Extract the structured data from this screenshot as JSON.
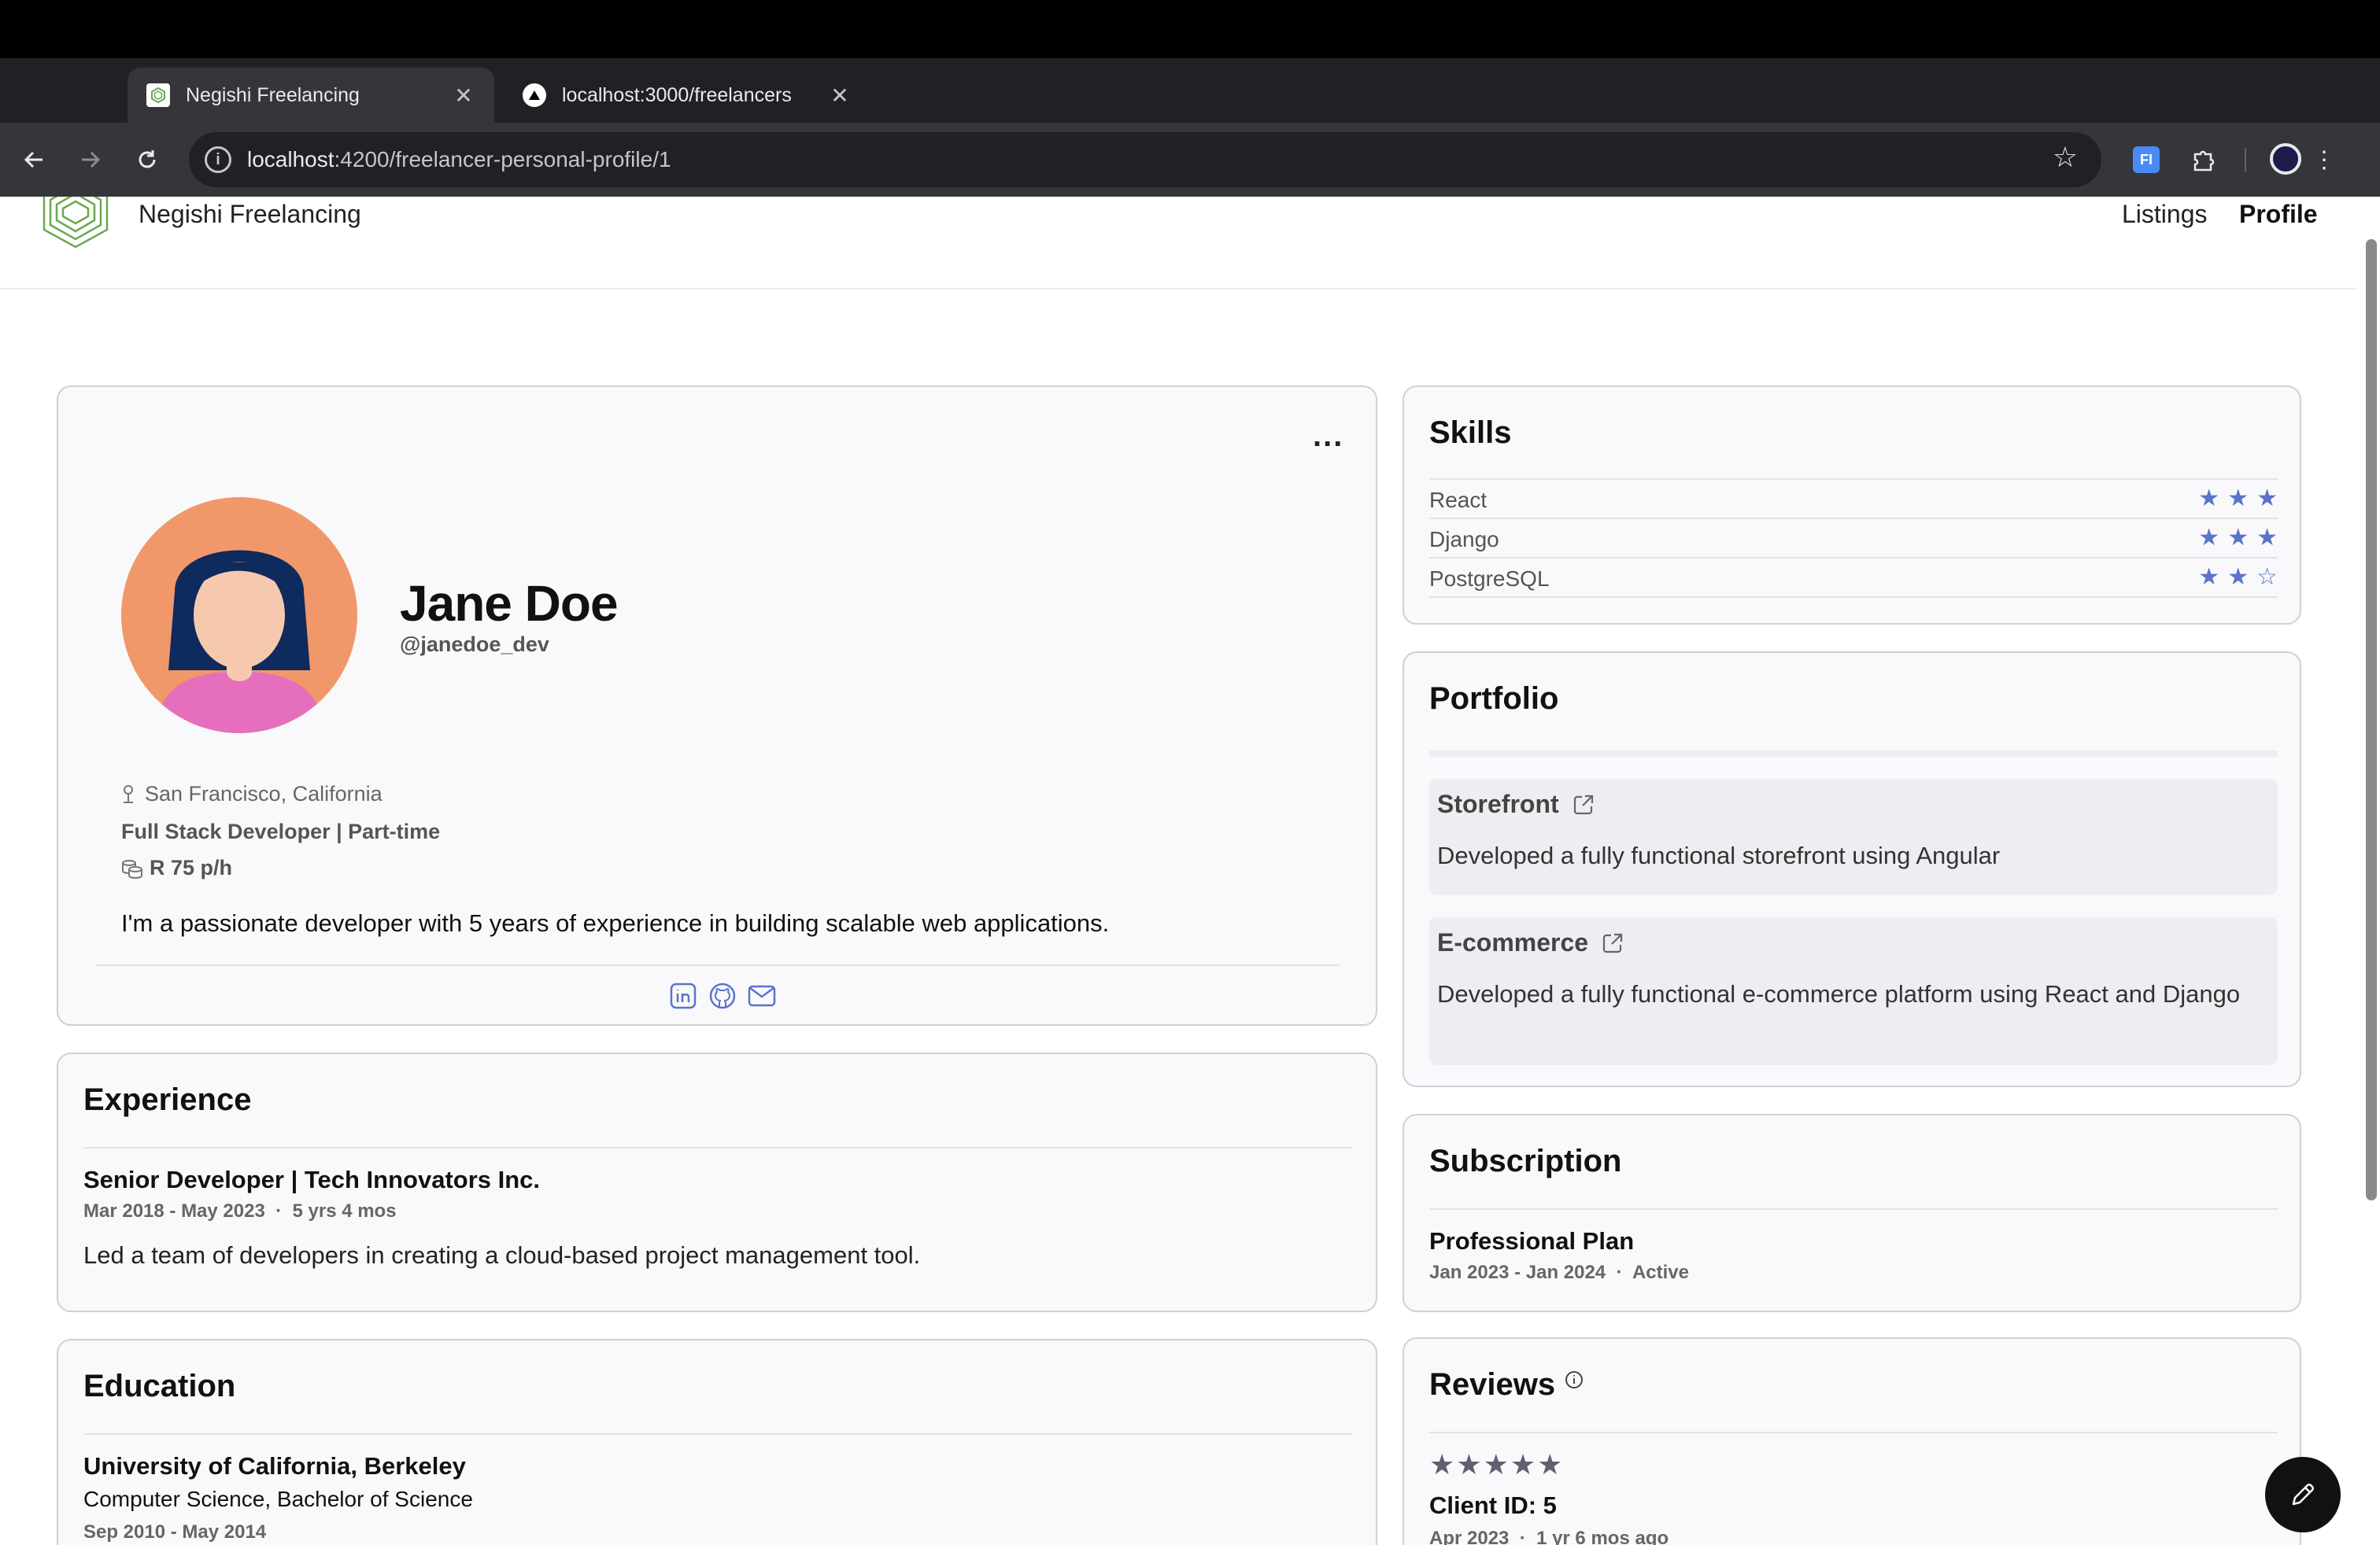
{
  "browser": {
    "tabs": [
      {
        "title": "Negishi Freelancing",
        "active": true
      },
      {
        "title": "localhost:3000/freelancers",
        "active": false
      }
    ],
    "url_host": "localhost",
    "url_path": ":4200/freelancer-personal-profile/1",
    "extension_label": "FI"
  },
  "header": {
    "brand": "Negishi Freelancing",
    "nav": {
      "listings": "Listings",
      "profile": "Profile"
    }
  },
  "profile": {
    "menu": "...",
    "name": "Jane Doe",
    "handle": "@janedoe_dev",
    "location": "San Francisco, California",
    "role": "Full Stack Developer | Part-time",
    "rate": "R 75 p/h",
    "bio": "I'm a passionate developer with 5 years of experience in building scalable web applications.",
    "social_icons": [
      "linkedin-icon",
      "github-icon",
      "mail-icon"
    ]
  },
  "experience": {
    "title": "Experience",
    "items": [
      {
        "title": "Senior Developer | Tech Innovators Inc.",
        "dates": "Mar 2018 - May 2023",
        "duration": "5 yrs 4 mos",
        "description": "Led a team of developers in creating a cloud-based project management tool."
      }
    ]
  },
  "education": {
    "title": "Education",
    "items": [
      {
        "school": "University of California, Berkeley",
        "degree": "Computer Science, Bachelor of Science",
        "dates": "Sep 2010 - May 2014"
      }
    ]
  },
  "skills": {
    "title": "Skills",
    "items": [
      {
        "name": "React",
        "rating": 3,
        "max": 3
      },
      {
        "name": "Django",
        "rating": 3,
        "max": 3
      },
      {
        "name": "PostgreSQL",
        "rating": 2,
        "max": 3
      }
    ]
  },
  "portfolio": {
    "title": "Portfolio",
    "items": [
      {
        "title": "Storefront",
        "description": "Developed a fully functional storefront using Angular"
      },
      {
        "title": "E-commerce",
        "description": "Developed a fully functional e-commerce platform using React and Django"
      }
    ]
  },
  "subscription": {
    "title": "Subscription",
    "plan": "Professional Plan",
    "dates": "Jan 2023 - Jan 2024",
    "status": "Active"
  },
  "reviews": {
    "title": "Reviews",
    "items": [
      {
        "rating": 5,
        "client": "Client ID: 5",
        "date": "Apr 2023",
        "ago": "1 yr 6 mos ago"
      }
    ]
  },
  "colors": {
    "star": "#5b74c8",
    "card_bg": "#f9f9fc",
    "card_border": "#cfd0d6"
  }
}
